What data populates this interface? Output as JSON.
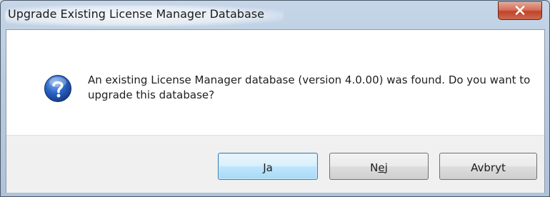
{
  "window": {
    "title": "Upgrade Existing License Manager Database",
    "close_label": "X"
  },
  "dialog": {
    "icon": "question-icon",
    "message": "An existing License Manager database (version 4.0.00) was found. Do you want to upgrade this database?"
  },
  "buttons": {
    "yes_label": "Ja",
    "no_prefix": "N",
    "no_mnemonic": "e",
    "no_suffix": "j",
    "cancel_label": "Avbryt"
  },
  "colors": {
    "close_button": "#c0432a",
    "default_button_border": "#3c7fb1",
    "icon_blue": "#1f4fa8"
  }
}
